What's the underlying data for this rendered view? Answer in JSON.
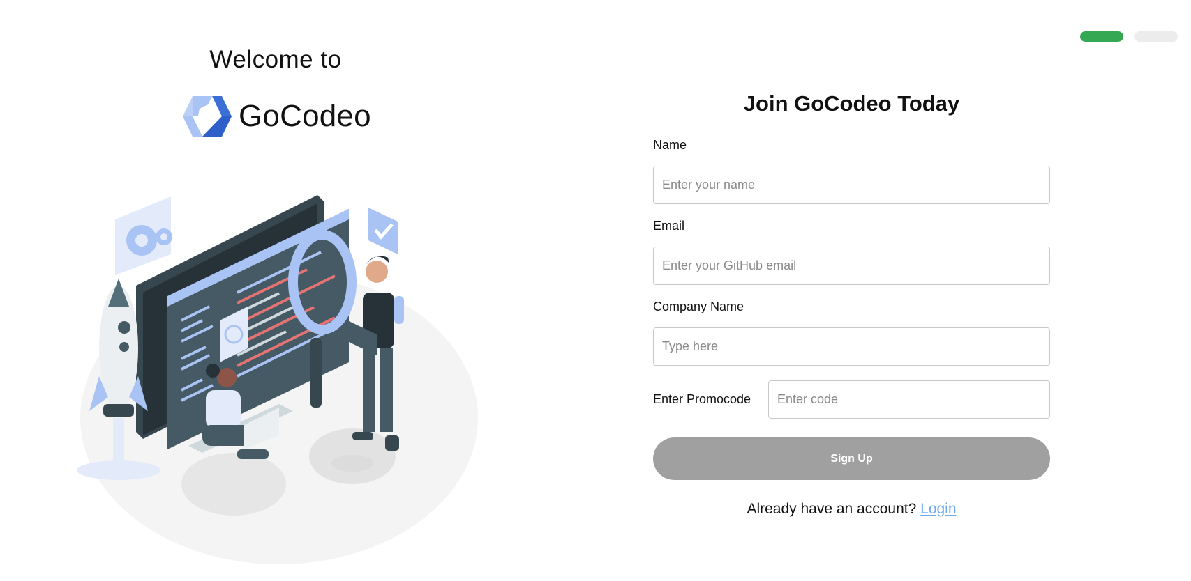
{
  "progress": {
    "current_step": 1,
    "total_steps": 2,
    "active_color": "#34a853",
    "inactive_color": "#ececec"
  },
  "left": {
    "welcome_text": "Welcome to",
    "brand_name": "GoCodeo",
    "logo_icon": "gocodeo-logo-icon",
    "illustration": "developer-workstation-illustration"
  },
  "form": {
    "title": "Join GoCodeo Today",
    "name_label": "Name",
    "name_placeholder": "Enter your name",
    "name_value": "",
    "email_label": "Email",
    "email_placeholder": "Enter your GitHub email",
    "email_value": "",
    "company_label": "Company Name",
    "company_placeholder": "Type here",
    "company_value": "",
    "promo_label": "Enter Promocode",
    "promo_placeholder": "Enter code",
    "promo_value": "",
    "submit_label": "Sign Up",
    "submit_color": "#a0a0a0",
    "footer_text": "Already have an account?",
    "login_label": "Login",
    "link_color": "#6aa9ea"
  }
}
